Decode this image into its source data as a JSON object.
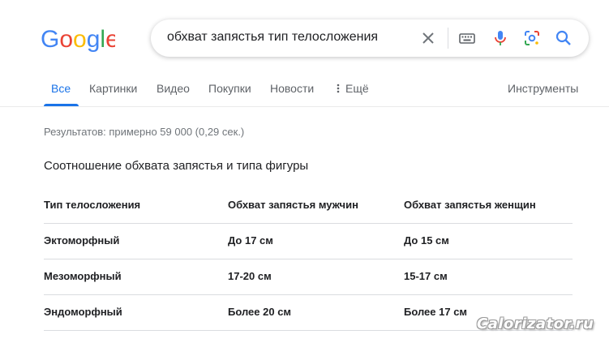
{
  "logo": {
    "text": "Google",
    "colors": [
      "#4285F4",
      "#EA4335",
      "#FBBC05",
      "#4285F4",
      "#34A853",
      "#EA4335"
    ]
  },
  "search": {
    "query": "обхват запястья тип телосложения",
    "icons": [
      "clear-icon",
      "keyboard-icon",
      "microphone-icon",
      "lens-icon",
      "search-icon"
    ]
  },
  "tabs": [
    {
      "label": "Все",
      "active": true
    },
    {
      "label": "Картинки",
      "active": false
    },
    {
      "label": "Видео",
      "active": false
    },
    {
      "label": "Покупки",
      "active": false
    },
    {
      "label": "Новости",
      "active": false
    },
    {
      "label": "Ещё",
      "active": false
    }
  ],
  "tools_label": "Инструменты",
  "result_stats": "Результатов: примерно 59 000 (0,29 сек.)",
  "snippet": {
    "heading": "Соотношение обхвата запястья и типа фигуры",
    "table": {
      "headers": [
        "Тип телосложения",
        "Обхват запястья мужчин",
        "Обхват запястья женщин"
      ],
      "rows": [
        [
          "Эктоморфный",
          "До 17 см",
          "До 15 см"
        ],
        [
          "Мезоморфный",
          "17-20 см",
          "15-17 см"
        ],
        [
          "Эндоморфный",
          "Более 20 см",
          "Более 17 см"
        ]
      ]
    }
  },
  "watermark": "Calorizator.ru",
  "colors": {
    "accent": "#1a73e8",
    "muted": "#5f6368",
    "text": "#202124"
  }
}
